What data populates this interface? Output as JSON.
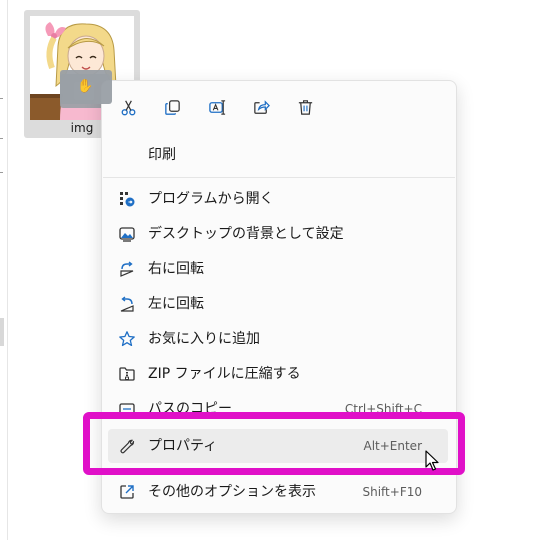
{
  "file": {
    "name": "img"
  },
  "quick_actions": [
    {
      "icon": "cut-icon"
    },
    {
      "icon": "copy-icon"
    },
    {
      "icon": "rename-icon"
    },
    {
      "icon": "share-icon"
    },
    {
      "icon": "delete-icon"
    }
  ],
  "menu": {
    "print": {
      "label": "印刷"
    },
    "items": [
      {
        "label": "プログラムから開く",
        "icon": "open-with-icon",
        "shortcut": ""
      },
      {
        "label": "デスクトップの背景として設定",
        "icon": "desktop-background-icon",
        "shortcut": ""
      },
      {
        "label": "右に回転",
        "icon": "rotate-right-icon",
        "shortcut": ""
      },
      {
        "label": "左に回転",
        "icon": "rotate-left-icon",
        "shortcut": ""
      },
      {
        "label": "お気に入りに追加",
        "icon": "star-icon",
        "shortcut": ""
      },
      {
        "label": "ZIP ファイルに圧縮する",
        "icon": "zip-icon",
        "shortcut": ""
      },
      {
        "label": "パスのコピー",
        "icon": "copy-path-icon",
        "shortcut": "Ctrl+Shift+C"
      },
      {
        "label": "プロパティ",
        "icon": "wrench-icon",
        "shortcut": "Alt+Enter"
      }
    ],
    "more_options": {
      "label": "その他のオプションを表示",
      "icon": "more-options-icon",
      "shortcut": "Shift+F10"
    }
  },
  "colors": {
    "highlight": "#e010c8",
    "icon_blue": "#1f6fc5"
  }
}
